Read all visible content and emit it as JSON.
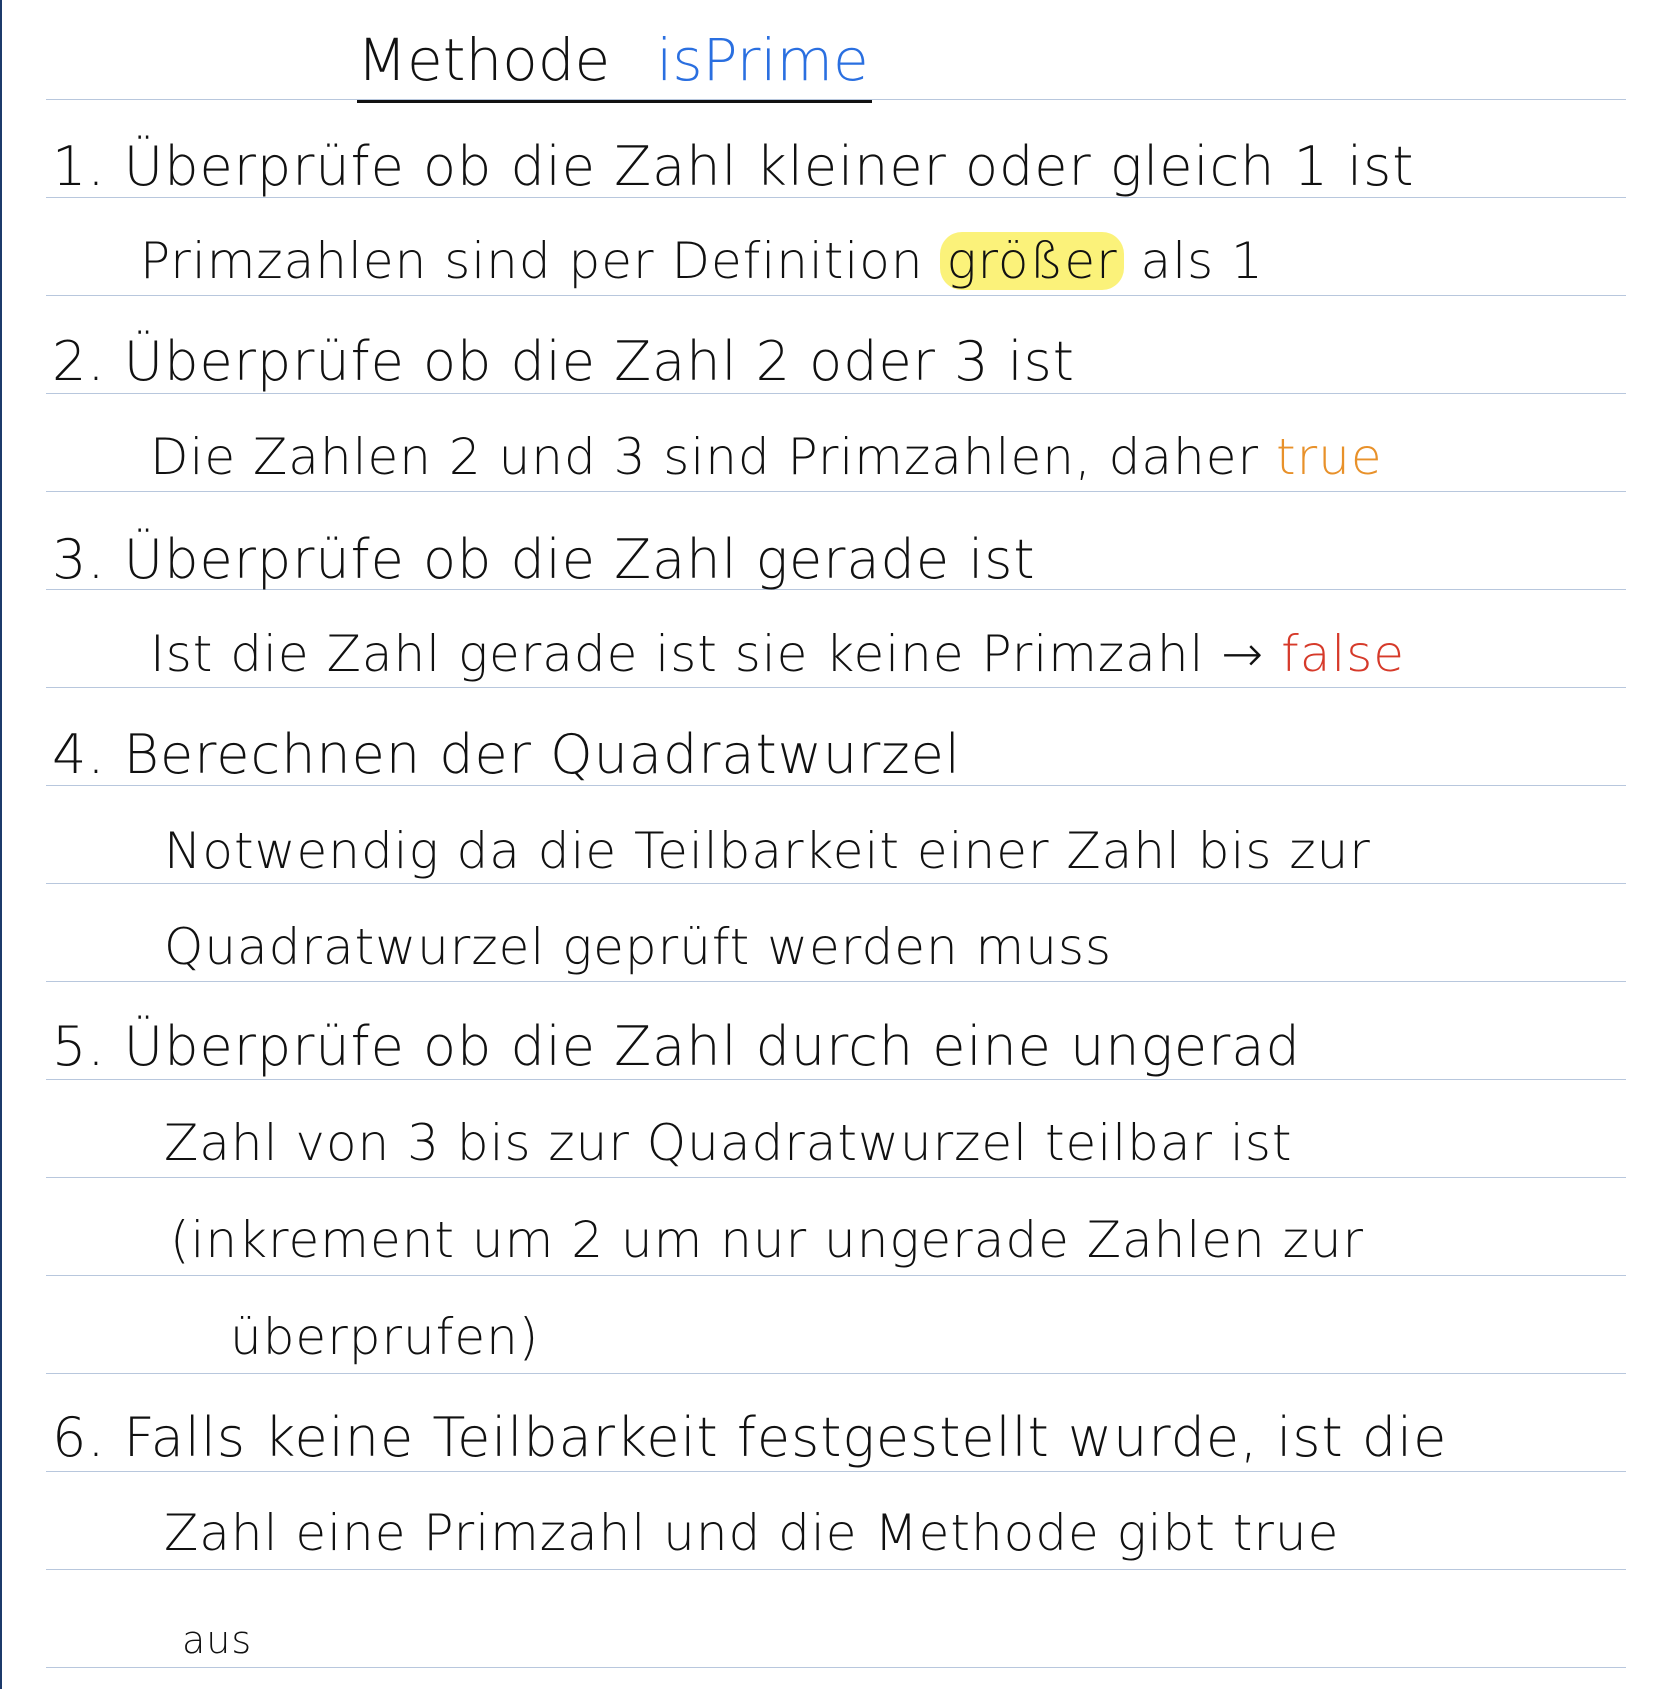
{
  "title": {
    "prefix": "Methode",
    "name": "isPrime"
  },
  "steps": [
    {
      "line1": "1. Überprüfe ob die Zahl kleiner oder gleich 1 ist",
      "line2_pre": "Primzahlen sind per Definition ",
      "line2_highlight": "größer",
      "line2_post": " als 1"
    },
    {
      "line1": "2. Überprüfe ob die Zahl 2 oder 3 ist",
      "line2_pre": "Die Zahlen 2 und 3 sind Primzahlen, daher ",
      "line2_colored": "true"
    },
    {
      "line1": "3. Überprüfe ob die Zahl gerade ist",
      "line2_pre": "Ist die Zahl gerade ist sie keine Primzahl → ",
      "line2_colored": "false"
    },
    {
      "line1": "4. Berechnen der Quadratwurzel",
      "line2": "Notwendig da die Teilbarkeit einer Zahl bis zur",
      "line3": "Quadratwurzel geprüft werden muss"
    },
    {
      "line1": "5. Überprüfe ob die Zahl durch eine ungerad",
      "line2": "Zahl von 3 bis zur Quadratwurzel teilbar ist",
      "line3": "(inkrement um 2 um nur ungerade Zahlen zur",
      "line4": "überprufen)"
    },
    {
      "line1": "6. Falls keine Teilbarkeit festgestellt wurde, ist die",
      "line2": "Zahl eine Primzahl und die Methode gibt true",
      "line3": "aus"
    }
  ],
  "colors": {
    "title_name": "#2a6fe0",
    "highlight": "#fbf27a",
    "true": "#e8912a",
    "false": "#d63a2a",
    "rule": "#b8c7dd"
  }
}
